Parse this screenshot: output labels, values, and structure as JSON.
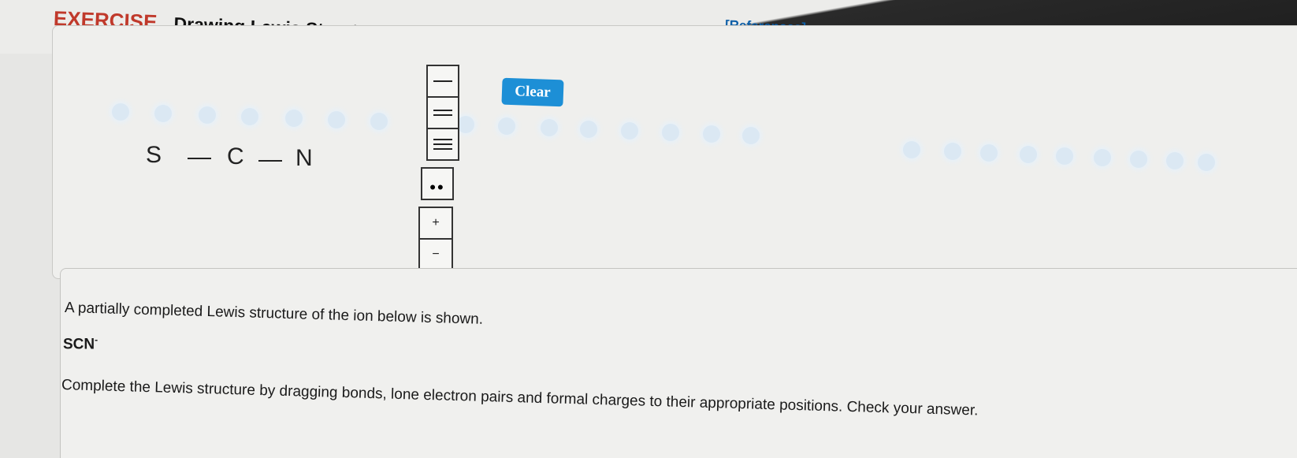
{
  "header": {
    "exercise_label": "EXERCISE",
    "title": "Drawing Lewis Structures with Formal Charges",
    "references_link": "[References]"
  },
  "workspace": {
    "atoms": [
      "S",
      "C",
      "N"
    ],
    "clear_button": "Clear",
    "charge_plus": "+",
    "charge_minus": "−",
    "lone_pair_symbol": "••"
  },
  "question": {
    "intro": "A partially completed Lewis structure of the ion below is shown.",
    "formula": "SCN",
    "charge": "-",
    "instruction": "Complete the Lewis structure by dragging bonds, lone electron pairs and formal charges to their appropriate positions. Check your answer."
  },
  "colors": {
    "accent": "#1d8fd6",
    "exercise_label": "#c0392b",
    "references": "#0d5fa8"
  }
}
